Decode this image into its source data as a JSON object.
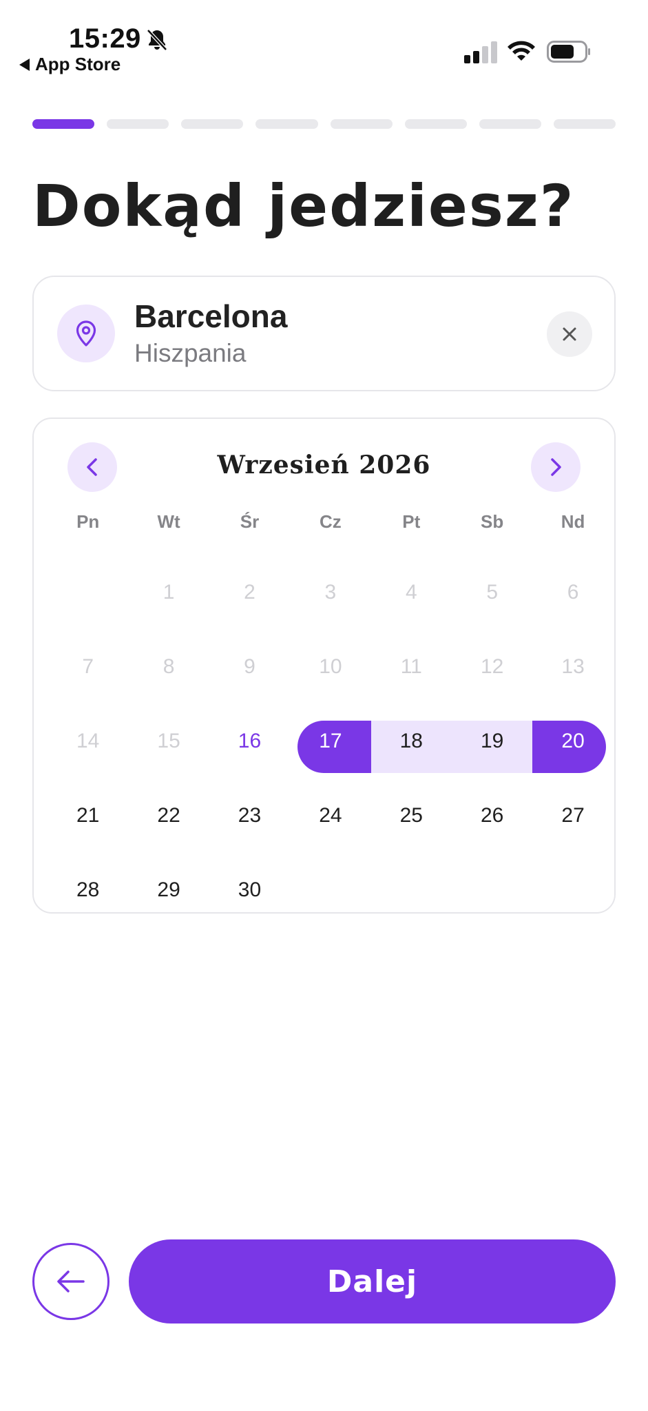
{
  "status_bar": {
    "time": "15:29",
    "back_label": "App Store",
    "icons": [
      "bell-slash-icon",
      "signal-icon",
      "wifi-icon",
      "battery-icon"
    ]
  },
  "progress": {
    "total_steps": 8,
    "current_step": 1
  },
  "title": "Dokąd jedziesz?",
  "destination": {
    "city": "Barcelona",
    "country": "Hiszpania",
    "icon": "map-pin-icon",
    "clear_icon": "close-icon"
  },
  "calendar": {
    "month_label": "Wrzesień 2026",
    "weekdays": [
      "Pn",
      "Wt",
      "Śr",
      "Cz",
      "Pt",
      "Sb",
      "Nd"
    ],
    "weeks": [
      [
        "",
        "1",
        "2",
        "3",
        "4",
        "5",
        "6"
      ],
      [
        "7",
        "8",
        "9",
        "10",
        "11",
        "12",
        "13"
      ],
      [
        "14",
        "15",
        "16",
        "17",
        "18",
        "19",
        "20"
      ],
      [
        "21",
        "22",
        "23",
        "24",
        "25",
        "26",
        "27"
      ],
      [
        "28",
        "29",
        "30",
        "",
        "",
        "",
        ""
      ]
    ],
    "disabled_through": 15,
    "today": 16,
    "range_start": 17,
    "range_end": 20
  },
  "footer": {
    "next_label": "Dalej",
    "back_icon": "arrow-left-icon"
  },
  "colors": {
    "accent": "#7a37e6",
    "accent_light": "#efe6fd",
    "border": "#e6e6ea",
    "muted": "#cfcfd3"
  }
}
